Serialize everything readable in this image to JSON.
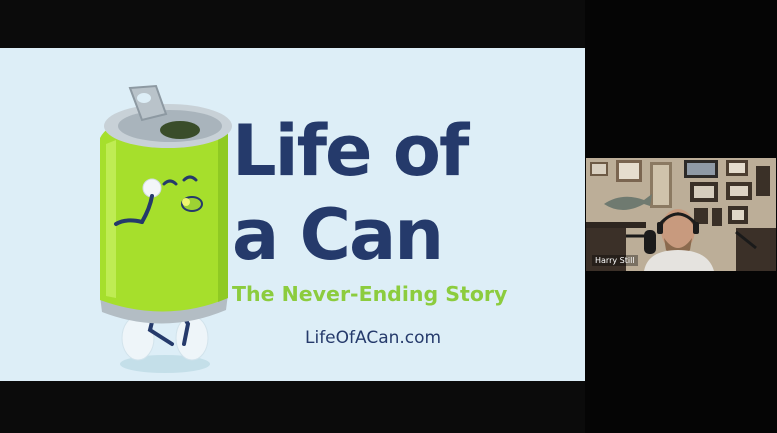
{
  "slide": {
    "title_line1": "Life of",
    "title_line2": "a Can",
    "tagline": "The Never-Ending Story",
    "website": "LifeOfACan.com",
    "colors": {
      "background": "#ddeef7",
      "title": "#253a6b",
      "tagline": "#8ccc3e",
      "can_body": "#a6df2c"
    },
    "mascot_icon": "smiling-can-mascot-icon"
  },
  "participant": {
    "name": "Harry Still",
    "avatar_icon": "person-video-feed-icon"
  }
}
